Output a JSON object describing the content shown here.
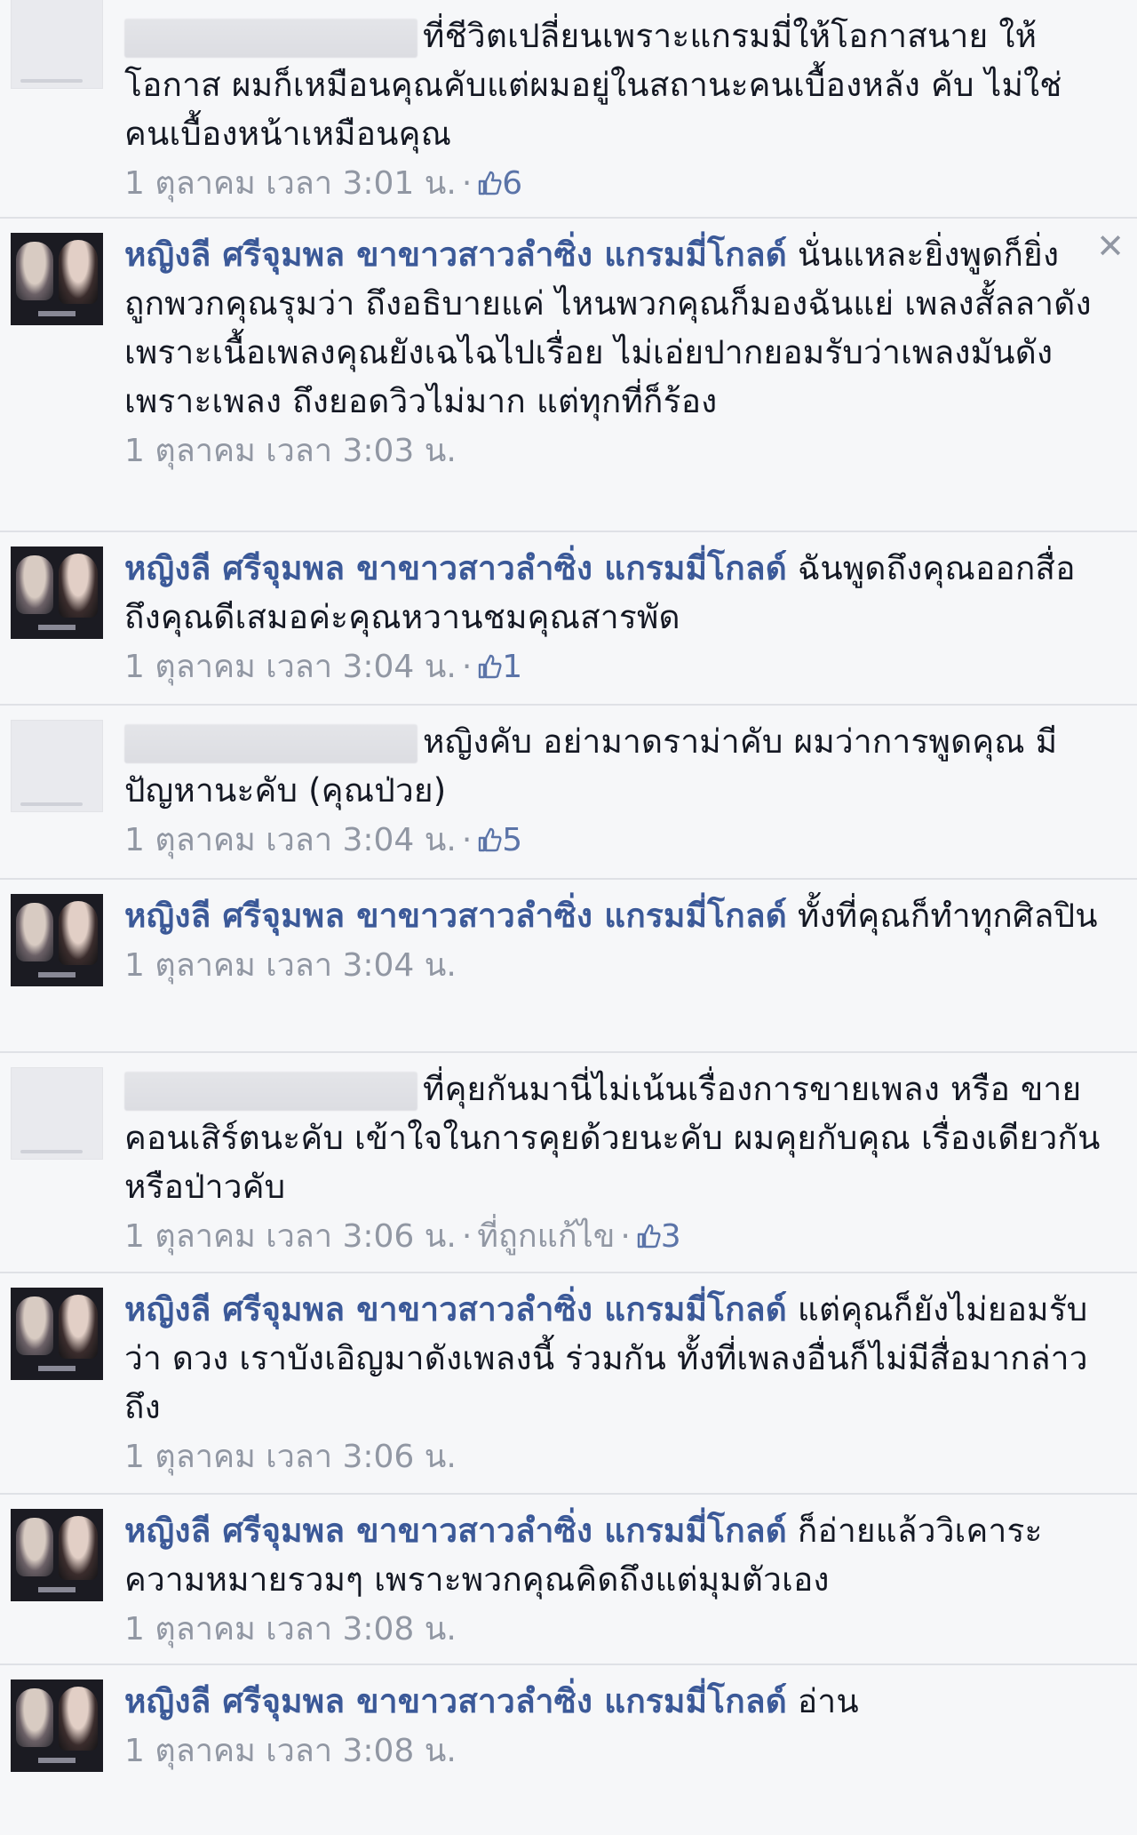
{
  "comments": [
    {
      "author": "",
      "blurred": true,
      "lines": [
        "ที่ชีวิตเปลี่ยนเพราะแกรมมี่ให้โอกาสนาย ให้โอกาส ผมก็เหมือนคุณคับแต่ผมอยู่ในสถานะคนเบื้องหลัง คับ ไม่ใช่คนเบื้องหน้าเหมือนคุณ"
      ],
      "time": "1 ตุลาคม เวลา 3:01 น.",
      "likes": "6"
    },
    {
      "author": "หญิงลี ศรีจุมพล ขาขาวสาวลำซิ่ง แกรมมี่โกลด์",
      "blurred": false,
      "lines": [
        "นั่นแหละยิ่งพูดก็ยิ่ง ถูกพวกคุณรุมว่า ถึงอธิบายแค่ ไหนพวกคุณก็มองฉันแย่ เพลงสั้ลลาดังเพราะเนื้อเพลงคุณยังเฉไฉไปเรื่อย ไม่เอ่ยปากยอมรับว่าเพลงมันดังเพราะเพลง ถึงยอดวิวไม่มาก แต่ทุกที่ก็ร้อง"
      ],
      "time": "1 ตุลาคม เวลา 3:03 น.",
      "likes": "",
      "close": "✕"
    },
    {
      "author": "หญิงลี ศรีจุมพล ขาขาวสาวลำซิ่ง แกรมมี่โกลด์",
      "blurred": false,
      "lines": [
        "ฉันพูดถึงคุณออกสื่อถึงคุณดีเสมอค่ะคุณหวานชมคุณสารพัด"
      ],
      "time": "1 ตุลาคม เวลา 3:04 น.",
      "likes": "1"
    },
    {
      "author": "",
      "blurred": true,
      "lines": [
        "หญิงคับ อย่ามาดราม่าคับ ผมว่าการพูดคุณ มีปัญหานะคับ (คุณป่วย)"
      ],
      "time": "1 ตุลาคม เวลา 3:04 น.",
      "likes": "5"
    },
    {
      "author": "หญิงลี ศรีจุมพล ขาขาวสาวลำซิ่ง แกรมมี่โกลด์",
      "blurred": false,
      "lines": [
        "ทั้งที่คุณก็ทำทุกศิลปิน"
      ],
      "time": "1 ตุลาคม เวลา 3:04 น.",
      "likes": ""
    },
    {
      "author": "",
      "blurred": true,
      "lines": [
        "ที่คุยกันมานี่ไม่เน้นเรื่องการขายเพลง หรือ ขายคอนเสิร์ตนะคับ เข้าใจในการคุยด้วยนะคับ ผมคุยกับคุณ เรื่องเดียวกันหรือป่าวคับ"
      ],
      "time": "1 ตุลาคม เวลา 3:06 น.",
      "edited": "ที่ถูกแก้ไข",
      "likes": "3"
    },
    {
      "author": "หญิงลี ศรีจุมพล ขาขาวสาวลำซิ่ง แกรมมี่โกลด์",
      "blurred": false,
      "lines": [
        "แต่คุณก็ยังไม่ยอมรับว่า ดวง เราบังเอิญมาดังเพลงนี้ ร่วมกัน ทั้งที่เพลงอื่นก็ไม่มีสื่อมากล่าวถึง"
      ],
      "time": "1 ตุลาคม เวลา 3:06 น.",
      "likes": ""
    },
    {
      "author": "หญิงลี ศรีจุมพล ขาขาวสาวลำซิ่ง แกรมมี่โกลด์",
      "blurred": false,
      "lines": [
        "ก็อ่ายแล้ววิเคาระความหมายรวมๆ เพราะพวกคุณคิดถึงแต่มุมตัวเอง"
      ],
      "time": "1 ตุลาคม เวลา 3:08 น.",
      "likes": ""
    },
    {
      "author": "หญิงลี ศรีจุมพล ขาขาวสาวลำซิ่ง แกรมมี่โกลด์",
      "blurred": false,
      "lines": [
        "อ่าน"
      ],
      "time": "1 ตุลาคม เวลา 3:08 น.",
      "likes": ""
    }
  ],
  "icons": {
    "like": "thumbs-up-icon",
    "close": "close-icon"
  },
  "colors": {
    "author": "#3b5998",
    "meta": "#9197a3",
    "background": "#f6f7f9"
  }
}
